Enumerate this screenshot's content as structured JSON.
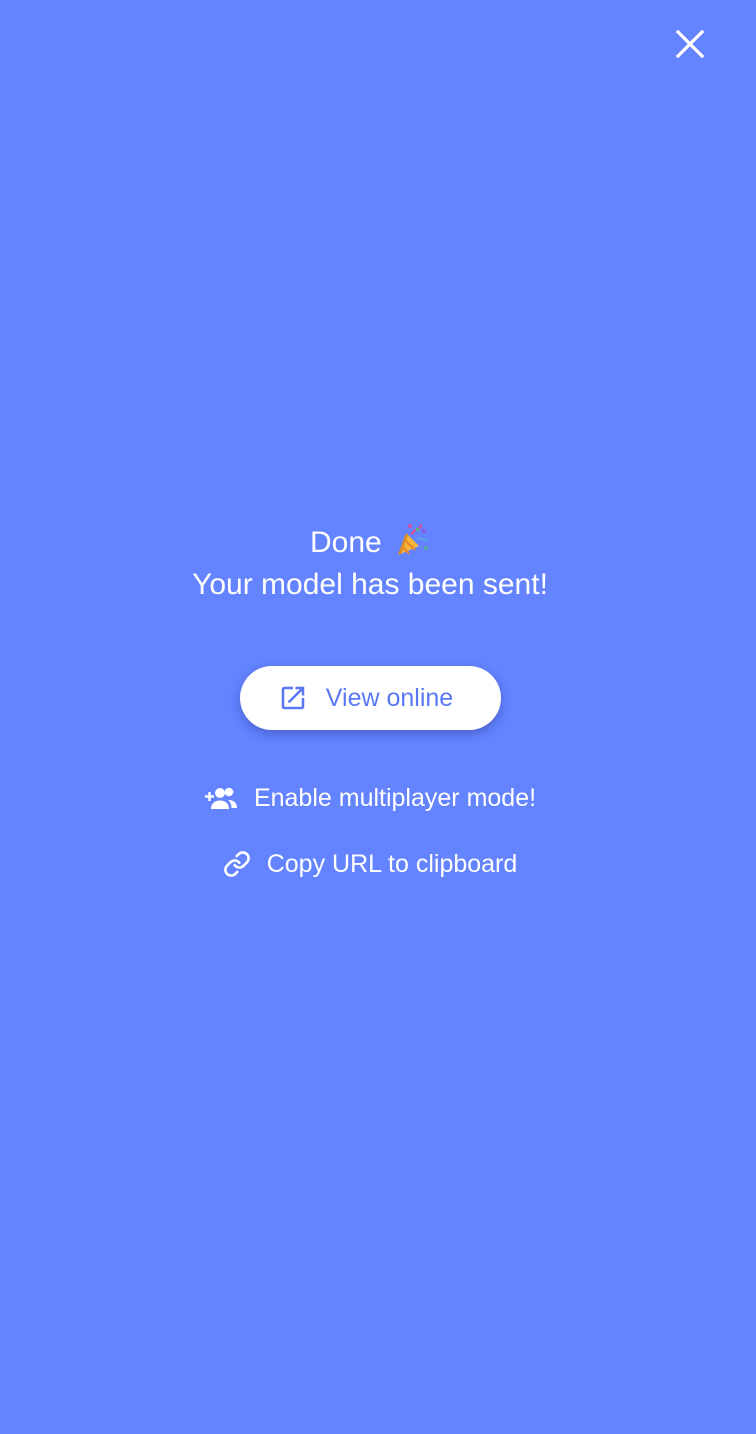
{
  "icons": {
    "close": "close-icon",
    "celebration": "party-popper-icon",
    "open_external": "open-in-new-icon",
    "add_group": "group-add-icon",
    "link": "link-icon"
  },
  "colors": {
    "background": "#6383ff",
    "button_background": "#ffffff",
    "button_text": "#5b78f4",
    "text": "#ffffff"
  },
  "headline": {
    "title": "Done",
    "subtitle": "Your model has been sent!"
  },
  "primary_action": {
    "label": "View online"
  },
  "secondary_actions": {
    "multiplayer_label": "Enable multiplayer mode!",
    "copy_url_label": "Copy URL to clipboard"
  }
}
